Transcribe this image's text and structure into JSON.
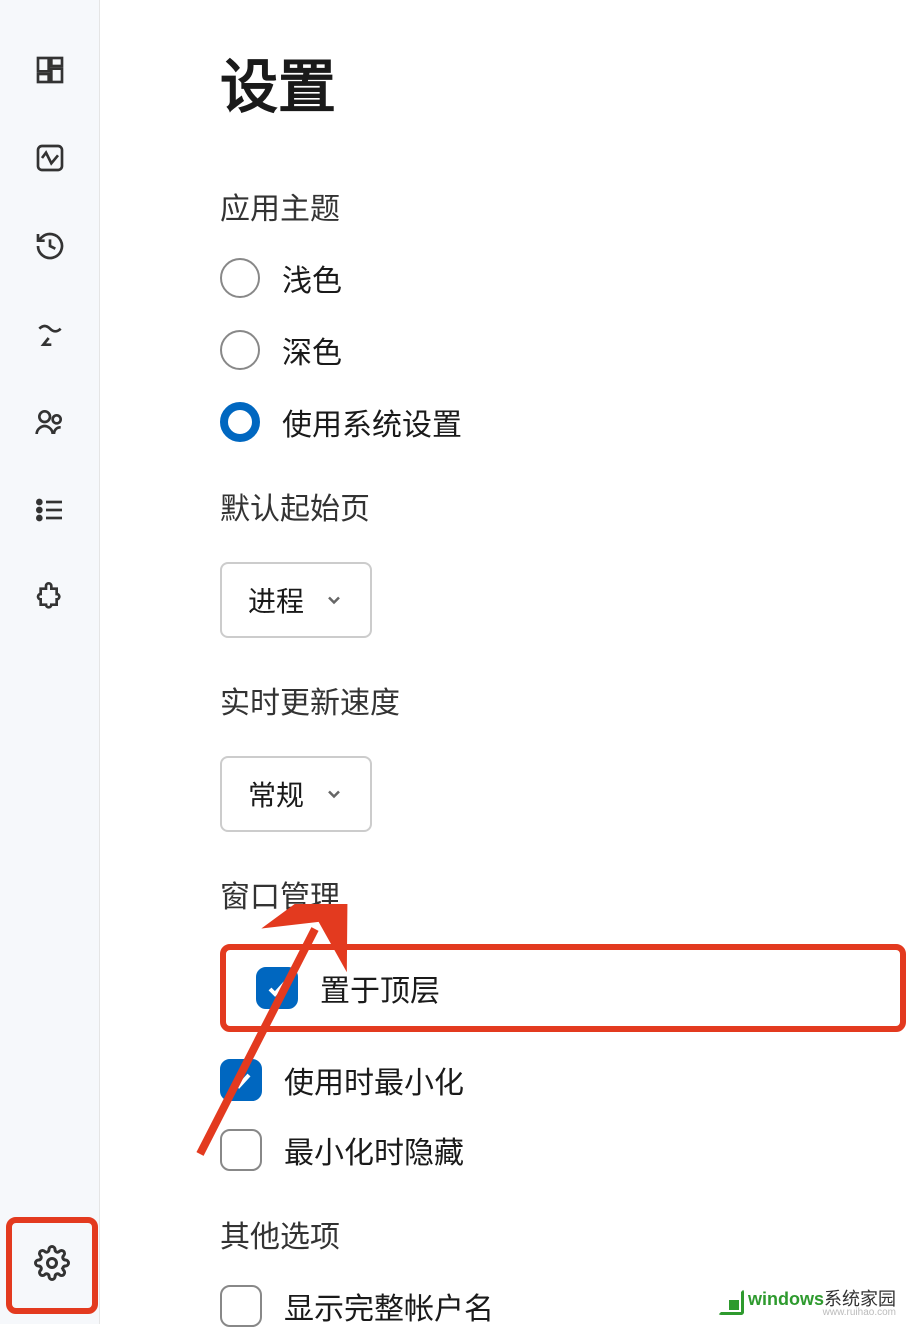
{
  "page": {
    "title": "设置"
  },
  "sections": {
    "theme": {
      "label": "应用主题",
      "options": {
        "light": "浅色",
        "dark": "深色",
        "system": "使用系统设置"
      },
      "selected": "system"
    },
    "startpage": {
      "label": "默认起始页",
      "value": "进程"
    },
    "updatespeed": {
      "label": "实时更新速度",
      "value": "常规"
    },
    "window": {
      "label": "窗口管理",
      "options": {
        "on_top": {
          "label": "置于顶层",
          "checked": true
        },
        "minimize_on_use": {
          "label": "使用时最小化",
          "checked": true
        },
        "hide_on_minimize": {
          "label": "最小化时隐藏",
          "checked": false
        }
      }
    },
    "other": {
      "label": "其他选项",
      "options": {
        "full_account": {
          "label": "显示完整帐户名",
          "checked": false
        }
      }
    }
  },
  "sidebar": {
    "icons": [
      "grid",
      "activity",
      "history",
      "efficiency",
      "users",
      "list",
      "extension"
    ],
    "bottom": "settings"
  },
  "watermark": {
    "brand1": "windows",
    "brand2": "系统家园",
    "sub": "www.ruihao.com"
  }
}
